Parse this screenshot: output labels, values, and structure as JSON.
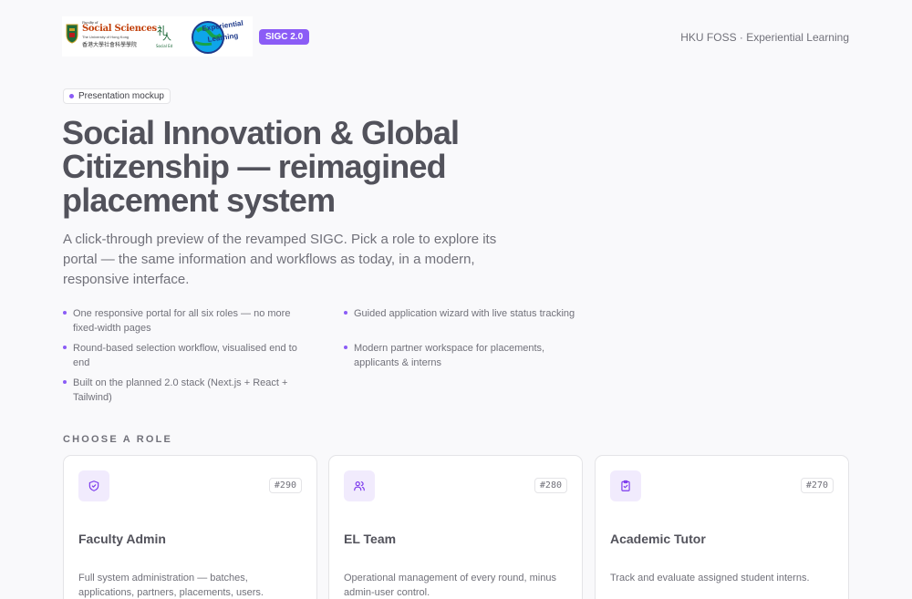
{
  "header": {
    "logos": {
      "faculty_line": "Faculty of",
      "faculty_name": "Social Sciences",
      "faculty_sub": "The University of Hong Kong",
      "faculty_cn": "香港大學社會科學學院",
      "small_logo_text": "Social Ed",
      "el_logo_text": "Experiential Learning"
    },
    "badge": "SIGC 2.0",
    "right_text": "HKU FOSS · Experiential Learning"
  },
  "hero": {
    "pill": "Presentation mockup",
    "title": "Social Innovation & Global Citizenship — reimagined placement system",
    "subtitle": "A click-through preview of the revamped SIGC. Pick a role to explore its portal — the same information and workflows as today, in a modern, responsive interface.",
    "features": [
      "One responsive portal for all six roles — no more fixed-width pages",
      "Guided application wizard with live status tracking",
      "Round-based selection workflow, visualised end to end",
      "Modern partner workspace for placements, applicants & interns",
      "Built on the planned 2.0 stack (Next.js + React + Tailwind)"
    ]
  },
  "roles": {
    "label": "CHOOSE A ROLE",
    "cards": [
      {
        "icon": "shield-check-icon",
        "code": "#290",
        "title": "Faculty Admin",
        "description": "Full system administration — batches, applications, partners, placements, users."
      },
      {
        "icon": "users-icon",
        "code": "#280",
        "title": "EL Team",
        "description": "Operational management of every round, minus admin-user control."
      },
      {
        "icon": "clipboard-check-icon",
        "code": "#270",
        "title": "Academic Tutor",
        "description": "Track and evaluate assigned student interns."
      }
    ]
  },
  "colors": {
    "accent": "#8b5cf6",
    "accent_soft": "#f1ebfd",
    "text": "#52525b",
    "muted": "#71717a",
    "background": "#f9f9fb"
  }
}
